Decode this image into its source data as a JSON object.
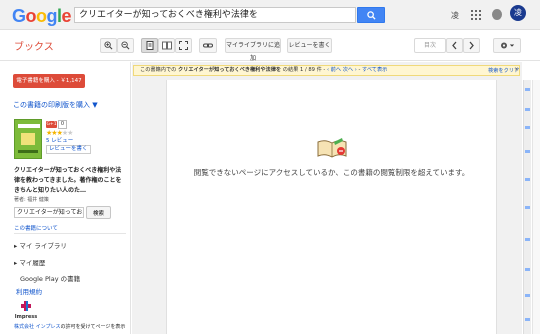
{
  "header": {
    "logo": {
      "letters": [
        "G",
        "o",
        "o",
        "g",
        "l",
        "e"
      ],
      "colors": [
        "#4285f4",
        "#ea4335",
        "#fbbc05",
        "#4285f4",
        "#34a853",
        "#ea4335"
      ]
    },
    "search_query": "クリエイターが知っておくべき権利や法律を",
    "user_initial": "凌",
    "avatar_initial": "凌"
  },
  "toolbar": {
    "brand": "ブックス",
    "add_library": "マイライブラリに追加",
    "write_review": "レビューを書く",
    "page_nav_label": "目次"
  },
  "sidebar": {
    "buy_button": "電子書籍を購入 - ￥1,147",
    "print_link": "この書籍の印刷版を購入 ▼",
    "gplus_label": "G+1",
    "gplus_count": "0",
    "rating": 3,
    "reviews_count": "5 レビュー",
    "write_review": "レビューを書く",
    "book_title": "クリエイターが知っておくべき権利や法律を教わってきました。著作権のことをきちんと知りたい人のた…",
    "author": "著者: 福井 健策",
    "book_search_value": "クリエイターが知ってお…",
    "book_search_button": "検索",
    "about_link": "この書籍について",
    "nav": [
      "マイ ライブラリ",
      "マイ履歴",
      "Google Play の書籍"
    ],
    "terms_link": "利用規約",
    "publisher_logo_text": "Impress",
    "publisher_note_link": "株式会社 インプレス",
    "publisher_note_rest": "の許可を受けてページを表示"
  },
  "main": {
    "infobar_prefix": "この書籍内での",
    "infobar_query": "クリエイターが知っておくべき権利や法律を",
    "infobar_result": "の結果 1 / 89 件",
    "infobar_prev": "‹ 前へ",
    "infobar_next": "次へ ›",
    "infobar_all": "すべて表示",
    "clear_search": "検索をクリア",
    "clear_x": "×",
    "message": "閲覧できないページにアクセスしているか、この書籍の閲覧制限を超えています。"
  }
}
